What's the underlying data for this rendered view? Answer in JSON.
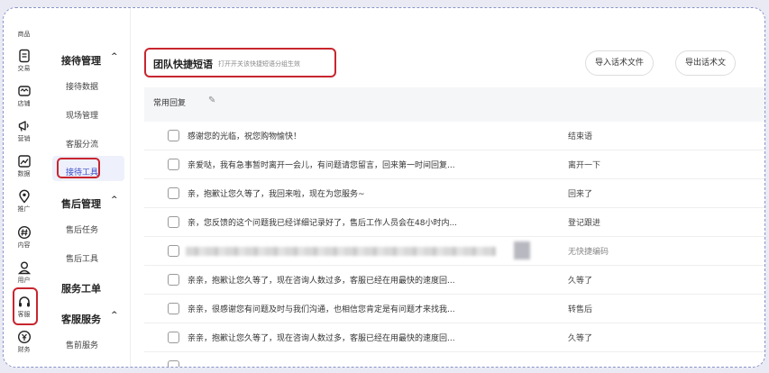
{
  "rail": {
    "top_label": "商品",
    "items": [
      {
        "label": "交易",
        "icon": "document-icon"
      },
      {
        "label": "店铺",
        "icon": "store-icon"
      },
      {
        "label": "营销",
        "icon": "megaphone-icon"
      },
      {
        "label": "数据",
        "icon": "chart-icon"
      },
      {
        "label": "推广",
        "icon": "location-icon"
      },
      {
        "label": "内容",
        "icon": "hash-icon"
      },
      {
        "label": "用户",
        "icon": "user-icon"
      },
      {
        "label": "客服",
        "icon": "headset-icon"
      },
      {
        "label": "财务",
        "icon": "finance-icon"
      }
    ]
  },
  "sub": {
    "sections": [
      {
        "label": "接待管理",
        "chevron": "^"
      },
      {
        "label": "售后管理",
        "chevron": "^"
      },
      {
        "label": "服务工单",
        "chevron": ""
      },
      {
        "label": "客服服务",
        "chevron": "^"
      }
    ],
    "items": [
      "接待数据",
      "现场管理",
      "客服分流",
      "接待工具",
      "售后任务",
      "售后工具",
      "售前服务"
    ]
  },
  "main": {
    "title": "团队快捷短语",
    "title_hint": "打开开关该快捷短语分组生效",
    "import_btn": "导入话术文件",
    "export_btn": "导出话术文",
    "group": "常用回复",
    "rows": [
      {
        "text": "感谢您的光临，祝您购物愉快！",
        "key": "结束语"
      },
      {
        "text": "亲爱哒，我有急事暂时离开一会儿，有问题请您留言，回来第一时间回复...",
        "key": "离开一下"
      },
      {
        "text": "亲，抱歉让您久等了，我回来啦，现在为您服务~",
        "key": "回来了"
      },
      {
        "text": "亲，您反馈的这个问题我已经详细记录好了，售后工作人员会在48小时内...",
        "key": "登记跟进"
      },
      {
        "text": "",
        "key": "无快捷编码"
      },
      {
        "text": "亲亲，抱歉让您久等了，现在咨询人数过多，客服已经在用最快的速度回...",
        "key": "久等了"
      },
      {
        "text": "亲亲，很感谢您有问题及时与我们沟通，也相信您肯定是有问题才来找我...",
        "key": "转售后"
      },
      {
        "text": "亲亲，抱歉让您久等了，现在咨询人数过多，客服已经在用最快的速度回...",
        "key": "久等了"
      }
    ]
  }
}
